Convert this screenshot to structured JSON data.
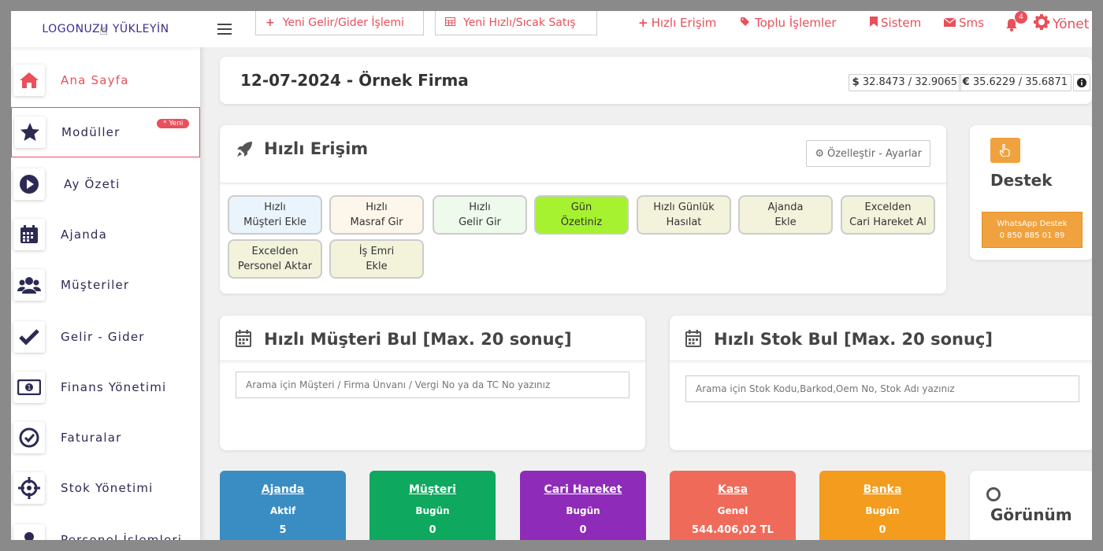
{
  "logo": {
    "text": "LOGONUZU YÜKLEYİN"
  },
  "sidebar": {
    "items": [
      {
        "label": "Ana Sayfa",
        "icon": "home-icon",
        "color": "#e8505b"
      },
      {
        "label": "Modüller",
        "icon": "star-icon",
        "badge": "* Yeni"
      },
      {
        "label": "Ay Özeti",
        "icon": "play-circle-icon"
      },
      {
        "label": "Ajanda",
        "icon": "calendar-icon"
      },
      {
        "label": "Müşteriler",
        "icon": "users-icon"
      },
      {
        "label": "Gelir - Gider",
        "icon": "check-icon"
      },
      {
        "label": "Finans Yönetimi",
        "icon": "money-icon"
      },
      {
        "label": "Faturalar",
        "icon": "check-circle-icon"
      },
      {
        "label": "Stok Yönetimi",
        "icon": "crosshairs-icon"
      },
      {
        "label": "Personel İşlemleri",
        "icon": "user-icon"
      }
    ]
  },
  "topbar": {
    "btn_income": "Yeni Gelir/Gider İşlemi",
    "btn_sale": "Yeni Hızlı/Sıcak Satış",
    "link_quick": "Hızlı Erişim",
    "link_bulk": "Toplu İşlemler",
    "link_system": "Sistem",
    "link_sms": "Sms",
    "notif_count": "4",
    "link_admin": "Yönet"
  },
  "header": {
    "title": "12-07-2024 - Örnek Firma",
    "usd_symbol": "$",
    "usd_rate": "32.8473 / 32.9065",
    "eur_symbol": "€",
    "eur_rate": "35.6229 / 35.6871"
  },
  "quick_access": {
    "title": "Hızlı Erişim",
    "settings_label": "Özelleştir - Ayarlar",
    "buttons": [
      {
        "l1": "Hızlı",
        "l2": "Müşteri Ekle",
        "bg": "#eaf4fc"
      },
      {
        "l1": "Hızlı",
        "l2": "Masraf Gir",
        "bg": "#fdf6ea"
      },
      {
        "l1": "Hızlı",
        "l2": "Gelir Gir",
        "bg": "#eefaec"
      },
      {
        "l1": "Gün",
        "l2": "Özetiniz",
        "bg": "#a6f230"
      },
      {
        "l1": "Hızlı Günlük",
        "l2": "Hasılat",
        "bg": "#f3f3dc"
      },
      {
        "l1": "Ajanda",
        "l2": "Ekle",
        "bg": "#f3f3dc"
      },
      {
        "l1": "Excelden",
        "l2": "Cari Hareket Al",
        "bg": "#f3f3dc"
      },
      {
        "l1": "Excelden",
        "l2": "Personel Aktar",
        "bg": "#f3f3dc"
      },
      {
        "l1": "İş Emri",
        "l2": "Ekle",
        "bg": "#f3f3dc"
      }
    ]
  },
  "support": {
    "title": "Destek",
    "whatsapp_label": "WhatsApp Destek",
    "phone": "0 850 885 01 89"
  },
  "customer_search": {
    "title": "Hızlı Müşteri Bul [Max. 20 sonuç]",
    "placeholder": "Arama için Müşteri / Firma Ünvanı / Vergi No ya da TC No yazınız"
  },
  "stock_search": {
    "title": "Hızlı Stok Bul [Max. 20 sonuç]",
    "placeholder": "Arama için Stok Kodu,Barkod,Oem No, Stok Adı yazınız"
  },
  "stats": [
    {
      "title": "Ajanda",
      "sub": "Aktif",
      "value": "5",
      "color": "#3a8dc2"
    },
    {
      "title": "Müşteri",
      "sub": "Bugün",
      "value": "0",
      "color": "#0ea85e"
    },
    {
      "title": "Cari Hareket",
      "sub": "Bugün",
      "value": "0",
      "color": "#8e2bb8"
    },
    {
      "title": "Kasa",
      "sub": "Genel",
      "value": "544.406,02 TL",
      "color": "#f06a5a"
    },
    {
      "title": "Banka",
      "sub": "Bugün",
      "value": "0",
      "color": "#f39c1e"
    }
  ],
  "view_panel": {
    "title": "Görünüm"
  }
}
